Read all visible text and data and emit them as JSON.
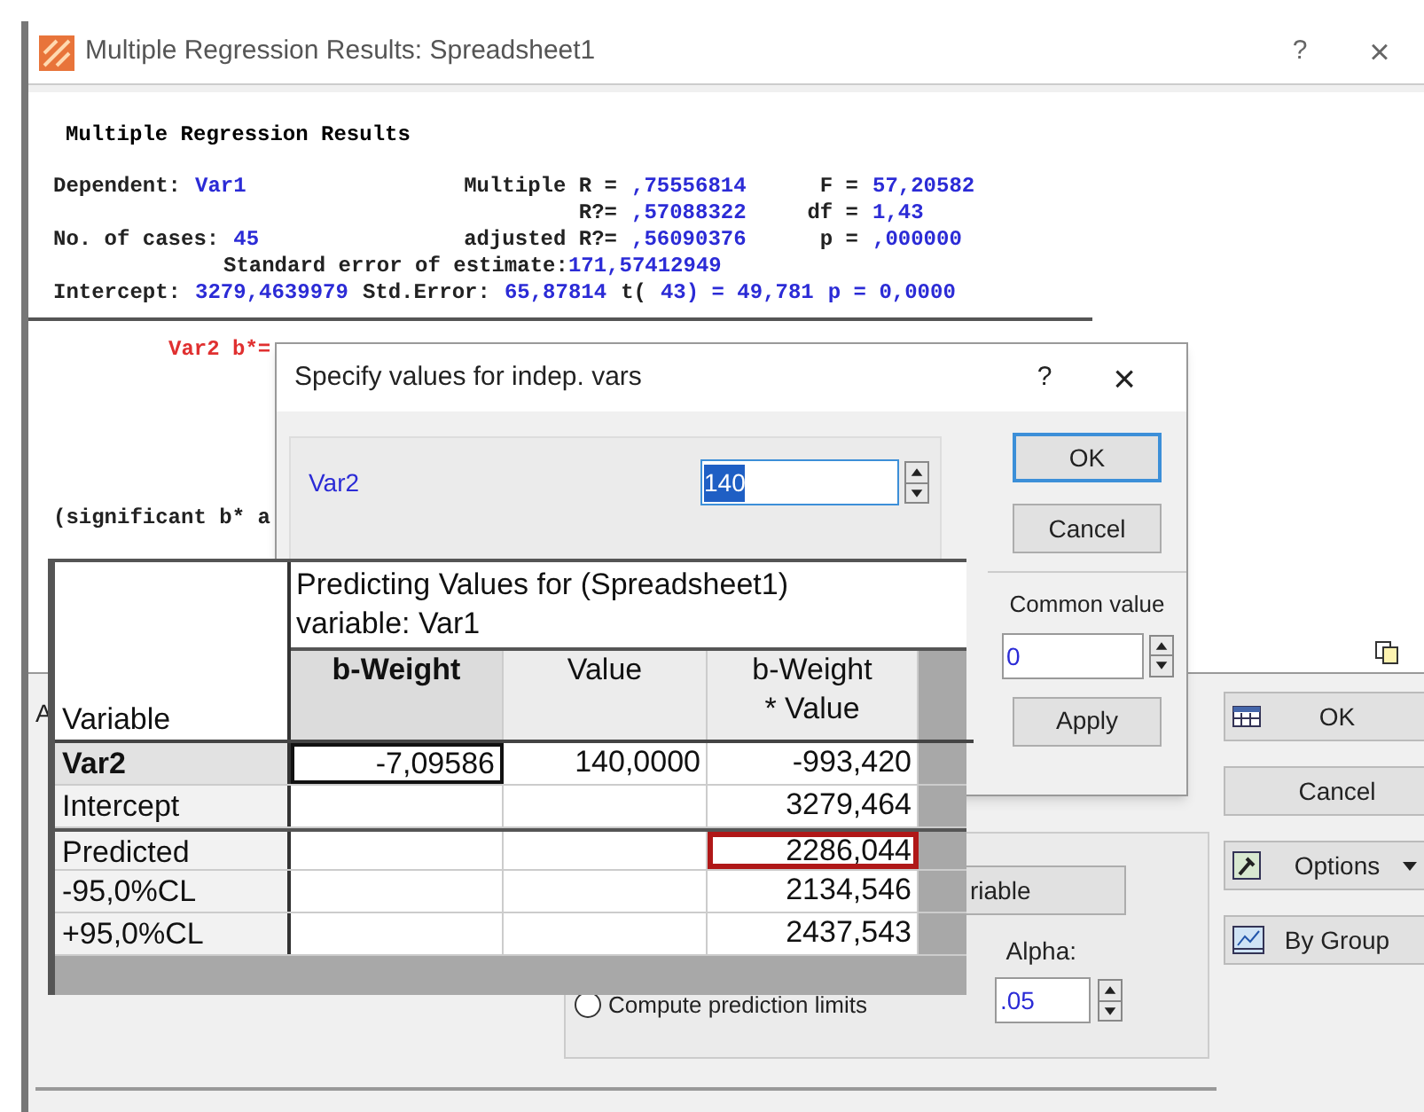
{
  "main_window": {
    "title": "Multiple Regression Results: Spreadsheet1",
    "help": "?",
    "close": "×",
    "results": {
      "heading": "Multiple Regression Results",
      "stats_rows": [
        [
          {
            "label": "Dependent:",
            "value": "Var1"
          },
          {
            "label": "Multiple R =",
            "value": ",75556814"
          },
          {
            "label": "F =",
            "value": "57,20582"
          }
        ],
        [
          null,
          {
            "label": "R?=",
            "value": ",57088322"
          },
          {
            "label": "df =",
            "value": "1,43"
          }
        ],
        [
          {
            "label": "No. of cases:",
            "value": "45"
          },
          {
            "label": "adjusted R?=",
            "value": ",56090376"
          },
          {
            "label": "p =",
            "value": ",000000"
          }
        ]
      ],
      "std_error": {
        "label": "Standard error of estimate:",
        "value": "171,57412949"
      },
      "intercept_line": [
        {
          "text": "Intercept:",
          "kind": "label"
        },
        {
          "text": "3279,4639979",
          "kind": "value"
        },
        {
          "text": "Std.Error:",
          "kind": "label"
        },
        {
          "text": "65,87814",
          "kind": "value"
        },
        {
          "text": "t(",
          "kind": "label"
        },
        {
          "text": "43) = 49,781",
          "kind": "value"
        },
        {
          "text": "p = 0,0000",
          "kind": "value"
        }
      ],
      "beta_label": "Var2 b*=",
      "note": "(significant b* a"
    },
    "lower_panel": {
      "cut_label": "A",
      "buttons": [
        {
          "label": "OK",
          "kind": "ok"
        },
        {
          "label": "Cancel",
          "kind": "plain"
        },
        {
          "label": "Options",
          "kind": "options"
        },
        {
          "label": "By Group",
          "kind": "group"
        }
      ],
      "variable_button": "riable",
      "alpha_label": "Alpha:",
      "alpha_value": ".05",
      "prediction_limits": {
        "label": "Compute prediction limits",
        "selected": false
      }
    }
  },
  "specify_dialog": {
    "title": "Specify values for indep. vars",
    "help": "?",
    "close": "×",
    "variables": [
      {
        "name": "Var2",
        "value": "140",
        "text_selected": true
      }
    ],
    "ok": "OK",
    "cancel": "Cancel",
    "common_value": {
      "label": "Common value",
      "value": "0",
      "apply": "Apply"
    }
  },
  "predicting_window": {
    "title_lines": [
      "Predicting Values for (Spreadsheet1)",
      "variable: Var1"
    ],
    "corner": "Variable",
    "columns": [
      {
        "lines": [
          "b-Weight"
        ],
        "selected": true
      },
      {
        "lines": [
          "Value"
        ],
        "selected": false
      },
      {
        "lines": [
          "b-Weight",
          "* Value"
        ],
        "selected": false
      }
    ],
    "rows": [
      {
        "label": "Var2",
        "selected": true,
        "cells": [
          {
            "text": "-7,09586",
            "focused": true,
            "highlighted": false
          },
          {
            "text": "140,0000",
            "focused": false,
            "highlighted": false
          },
          {
            "text": "-993,420",
            "focused": false,
            "highlighted": false
          }
        ]
      },
      {
        "label": "Intercept",
        "selected": false,
        "cells": [
          {
            "focused": false,
            "highlighted": false
          },
          {
            "focused": false,
            "highlighted": false
          },
          {
            "text": "3279,464",
            "focused": false,
            "highlighted": false
          }
        ]
      },
      {
        "label": "Predicted",
        "selected": false,
        "cells": [
          {
            "focused": false,
            "highlighted": false
          },
          {
            "focused": false,
            "highlighted": false
          },
          {
            "text": "2286,044",
            "focused": false,
            "highlighted": true
          }
        ]
      },
      {
        "label": "-95,0%CL",
        "selected": false,
        "cells": [
          {
            "focused": false,
            "highlighted": false
          },
          {
            "focused": false,
            "highlighted": false
          },
          {
            "text": "2134,546",
            "focused": false,
            "highlighted": false
          }
        ]
      },
      {
        "label": "+95,0%CL",
        "selected": false,
        "cells": [
          {
            "focused": false,
            "highlighted": false
          },
          {
            "focused": false,
            "highlighted": false
          },
          {
            "text": "2437,543",
            "focused": false,
            "highlighted": false
          }
        ]
      }
    ]
  }
}
